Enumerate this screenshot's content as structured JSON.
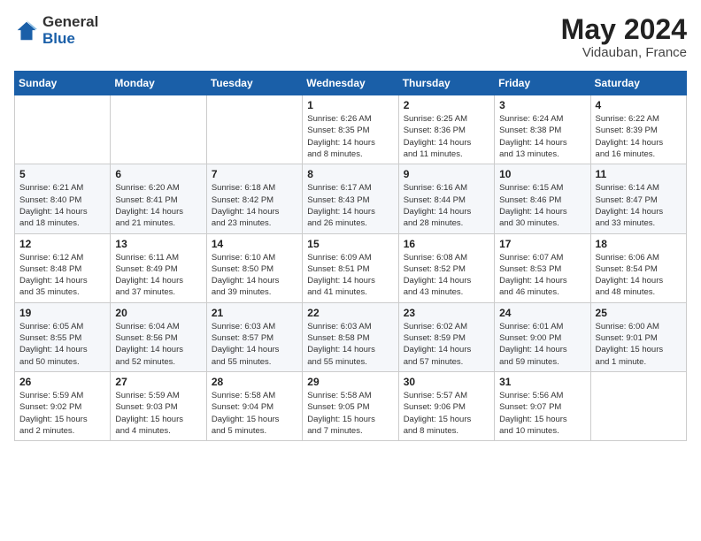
{
  "logo": {
    "general": "General",
    "blue": "Blue"
  },
  "title": "May 2024",
  "subtitle": "Vidauban, France",
  "days_of_week": [
    "Sunday",
    "Monday",
    "Tuesday",
    "Wednesday",
    "Thursday",
    "Friday",
    "Saturday"
  ],
  "weeks": [
    [
      {
        "day": "",
        "info": ""
      },
      {
        "day": "",
        "info": ""
      },
      {
        "day": "",
        "info": ""
      },
      {
        "day": "1",
        "info": "Sunrise: 6:26 AM\nSunset: 8:35 PM\nDaylight: 14 hours\nand 8 minutes."
      },
      {
        "day": "2",
        "info": "Sunrise: 6:25 AM\nSunset: 8:36 PM\nDaylight: 14 hours\nand 11 minutes."
      },
      {
        "day": "3",
        "info": "Sunrise: 6:24 AM\nSunset: 8:38 PM\nDaylight: 14 hours\nand 13 minutes."
      },
      {
        "day": "4",
        "info": "Sunrise: 6:22 AM\nSunset: 8:39 PM\nDaylight: 14 hours\nand 16 minutes."
      }
    ],
    [
      {
        "day": "5",
        "info": "Sunrise: 6:21 AM\nSunset: 8:40 PM\nDaylight: 14 hours\nand 18 minutes."
      },
      {
        "day": "6",
        "info": "Sunrise: 6:20 AM\nSunset: 8:41 PM\nDaylight: 14 hours\nand 21 minutes."
      },
      {
        "day": "7",
        "info": "Sunrise: 6:18 AM\nSunset: 8:42 PM\nDaylight: 14 hours\nand 23 minutes."
      },
      {
        "day": "8",
        "info": "Sunrise: 6:17 AM\nSunset: 8:43 PM\nDaylight: 14 hours\nand 26 minutes."
      },
      {
        "day": "9",
        "info": "Sunrise: 6:16 AM\nSunset: 8:44 PM\nDaylight: 14 hours\nand 28 minutes."
      },
      {
        "day": "10",
        "info": "Sunrise: 6:15 AM\nSunset: 8:46 PM\nDaylight: 14 hours\nand 30 minutes."
      },
      {
        "day": "11",
        "info": "Sunrise: 6:14 AM\nSunset: 8:47 PM\nDaylight: 14 hours\nand 33 minutes."
      }
    ],
    [
      {
        "day": "12",
        "info": "Sunrise: 6:12 AM\nSunset: 8:48 PM\nDaylight: 14 hours\nand 35 minutes."
      },
      {
        "day": "13",
        "info": "Sunrise: 6:11 AM\nSunset: 8:49 PM\nDaylight: 14 hours\nand 37 minutes."
      },
      {
        "day": "14",
        "info": "Sunrise: 6:10 AM\nSunset: 8:50 PM\nDaylight: 14 hours\nand 39 minutes."
      },
      {
        "day": "15",
        "info": "Sunrise: 6:09 AM\nSunset: 8:51 PM\nDaylight: 14 hours\nand 41 minutes."
      },
      {
        "day": "16",
        "info": "Sunrise: 6:08 AM\nSunset: 8:52 PM\nDaylight: 14 hours\nand 43 minutes."
      },
      {
        "day": "17",
        "info": "Sunrise: 6:07 AM\nSunset: 8:53 PM\nDaylight: 14 hours\nand 46 minutes."
      },
      {
        "day": "18",
        "info": "Sunrise: 6:06 AM\nSunset: 8:54 PM\nDaylight: 14 hours\nand 48 minutes."
      }
    ],
    [
      {
        "day": "19",
        "info": "Sunrise: 6:05 AM\nSunset: 8:55 PM\nDaylight: 14 hours\nand 50 minutes."
      },
      {
        "day": "20",
        "info": "Sunrise: 6:04 AM\nSunset: 8:56 PM\nDaylight: 14 hours\nand 52 minutes."
      },
      {
        "day": "21",
        "info": "Sunrise: 6:03 AM\nSunset: 8:57 PM\nDaylight: 14 hours\nand 55 minutes."
      },
      {
        "day": "22",
        "info": "Sunrise: 6:03 AM\nSunset: 8:58 PM\nDaylight: 14 hours\nand 55 minutes."
      },
      {
        "day": "23",
        "info": "Sunrise: 6:02 AM\nSunset: 8:59 PM\nDaylight: 14 hours\nand 57 minutes."
      },
      {
        "day": "24",
        "info": "Sunrise: 6:01 AM\nSunset: 9:00 PM\nDaylight: 14 hours\nand 59 minutes."
      },
      {
        "day": "25",
        "info": "Sunrise: 6:00 AM\nSunset: 9:01 PM\nDaylight: 15 hours\nand 1 minute."
      }
    ],
    [
      {
        "day": "26",
        "info": "Sunrise: 5:59 AM\nSunset: 9:02 PM\nDaylight: 15 hours\nand 2 minutes."
      },
      {
        "day": "27",
        "info": "Sunrise: 5:59 AM\nSunset: 9:03 PM\nDaylight: 15 hours\nand 4 minutes."
      },
      {
        "day": "28",
        "info": "Sunrise: 5:58 AM\nSunset: 9:04 PM\nDaylight: 15 hours\nand 5 minutes."
      },
      {
        "day": "29",
        "info": "Sunrise: 5:58 AM\nSunset: 9:05 PM\nDaylight: 15 hours\nand 7 minutes."
      },
      {
        "day": "30",
        "info": "Sunrise: 5:57 AM\nSunset: 9:06 PM\nDaylight: 15 hours\nand 8 minutes."
      },
      {
        "day": "31",
        "info": "Sunrise: 5:56 AM\nSunset: 9:07 PM\nDaylight: 15 hours\nand 10 minutes."
      },
      {
        "day": "",
        "info": ""
      }
    ]
  ]
}
